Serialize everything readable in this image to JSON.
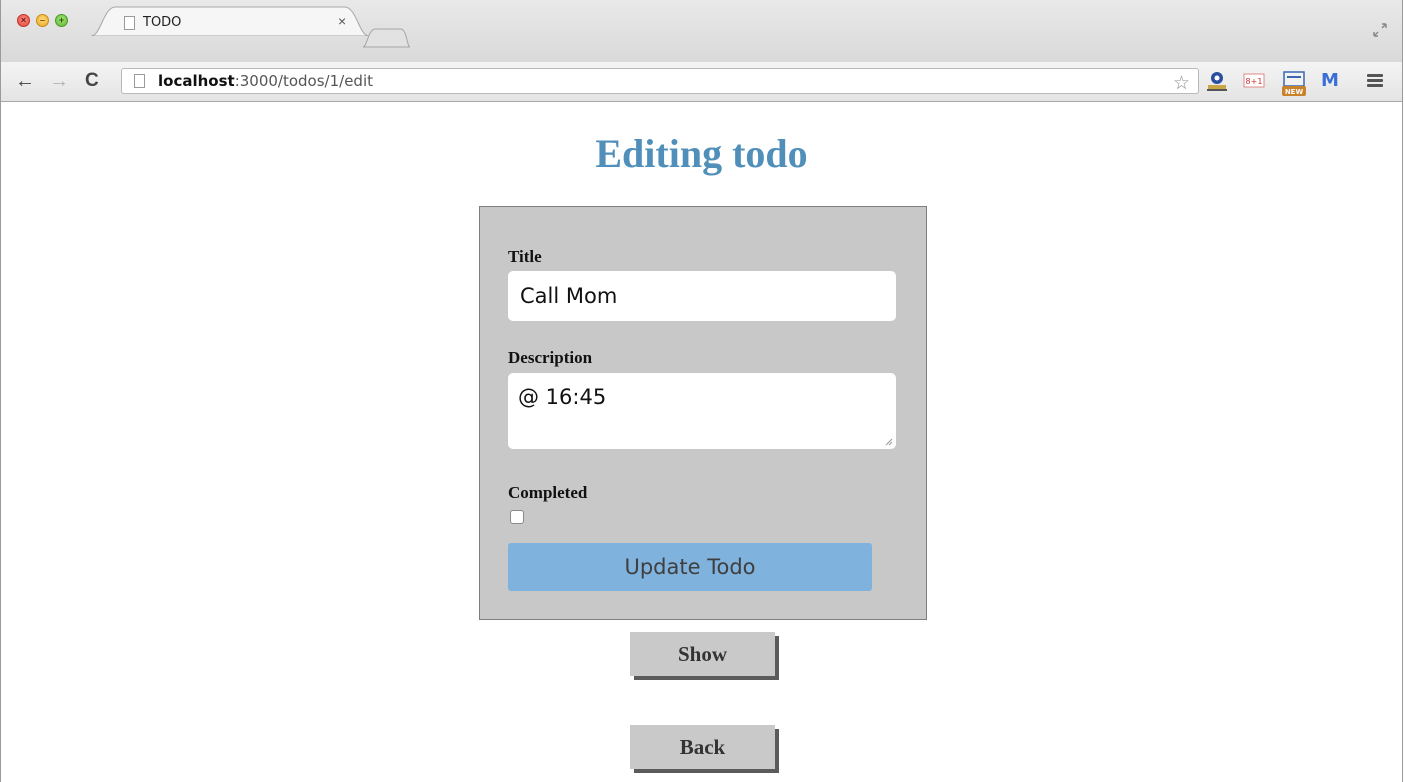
{
  "browser": {
    "tab_title": "TODO",
    "tab_close_glyph": "×",
    "url_host": "localhost",
    "url_path": ":3000/todos/1/edit",
    "extensions": {
      "gplus_label": "8+1",
      "new_badge": "NEW",
      "m_label": "M"
    }
  },
  "page": {
    "heading": "Editing todo",
    "heading_color": "#4f8fba",
    "form": {
      "title_label": "Title",
      "title_value": "Call Mom",
      "description_label": "Description",
      "description_value": "@ 16:45",
      "completed_label": "Completed",
      "completed_checked": false,
      "submit_label": "Update Todo",
      "submit_color": "#7fb2dc"
    },
    "links": {
      "show_label": "Show",
      "back_label": "Back"
    }
  }
}
